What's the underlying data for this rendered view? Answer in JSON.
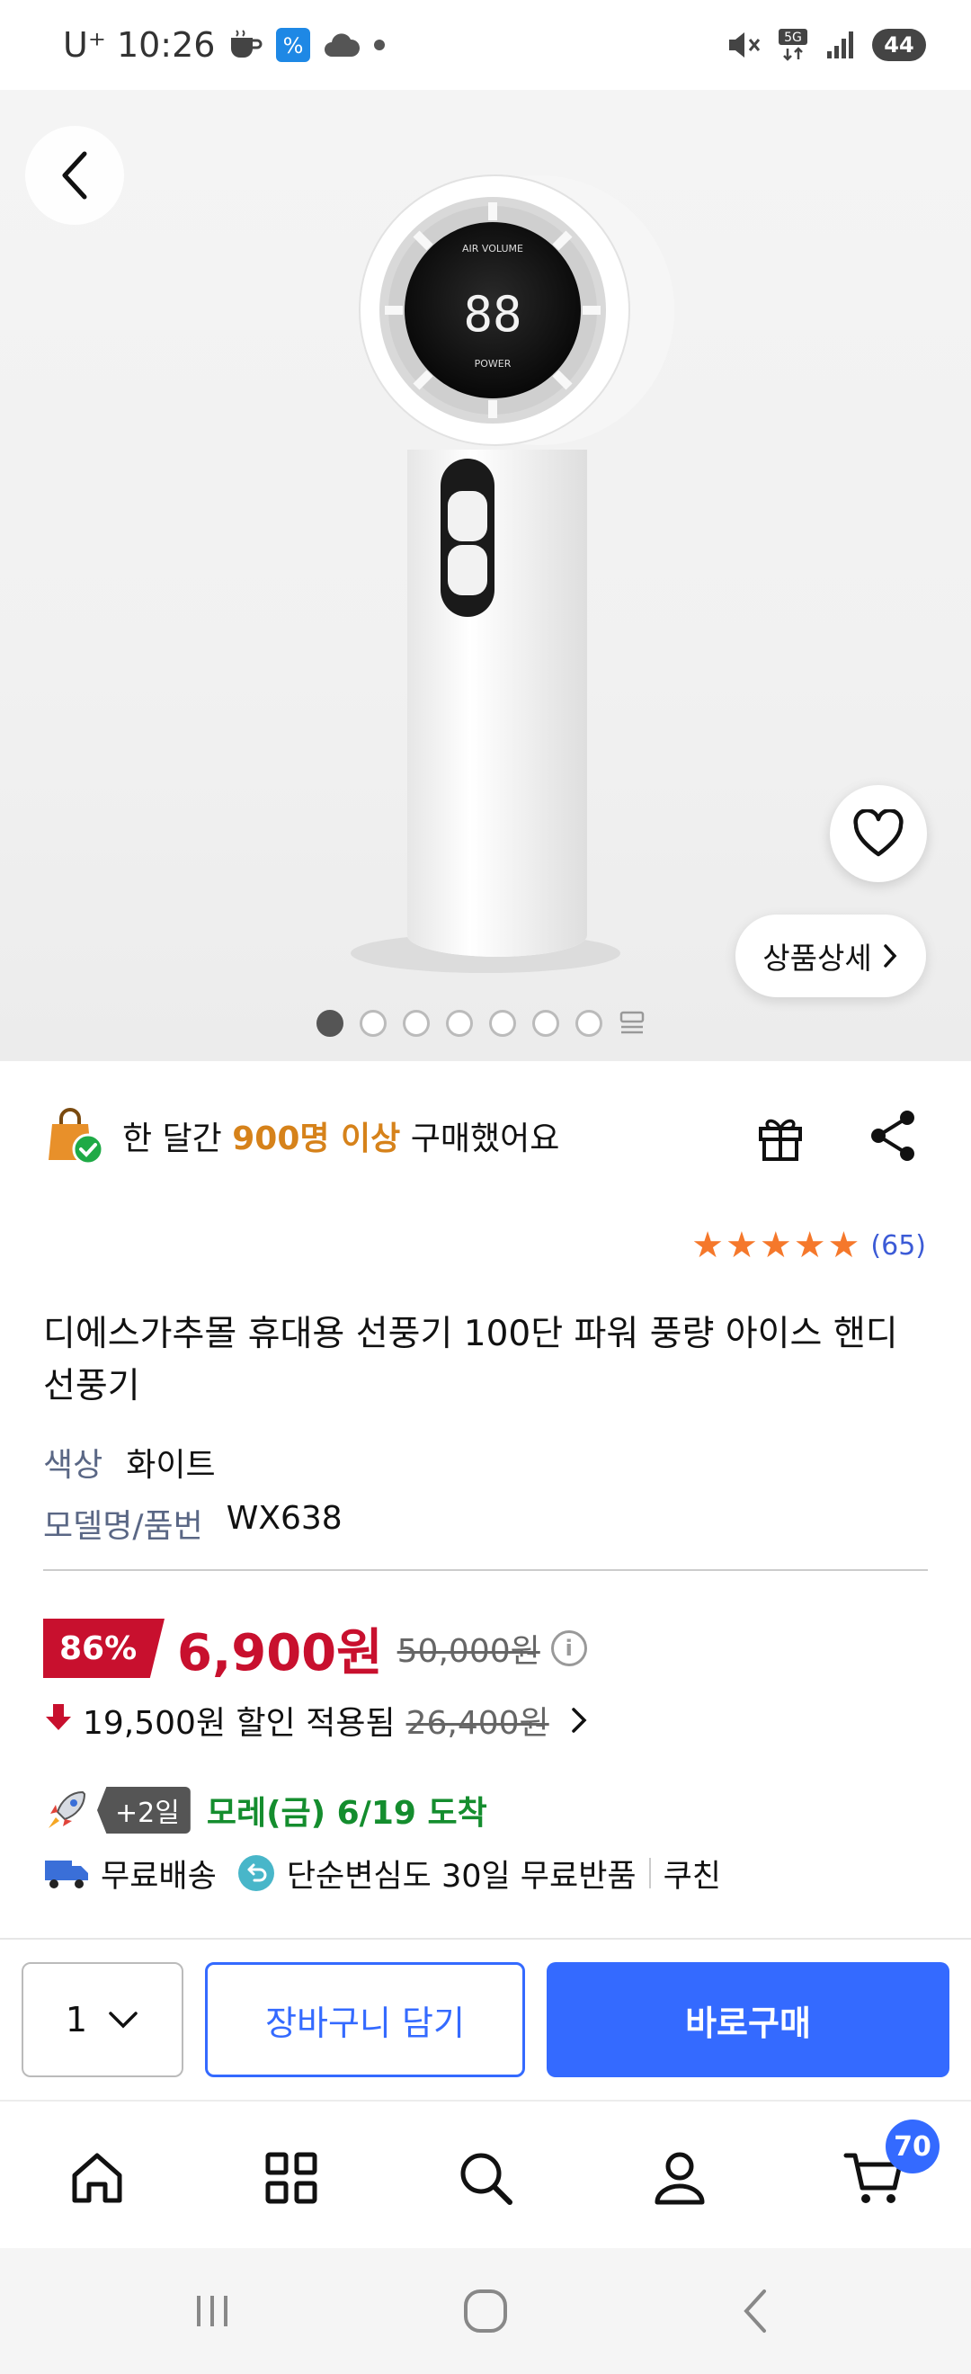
{
  "status_bar": {
    "carrier_time": "U⁺ 10:26",
    "network": "5G",
    "battery": "44"
  },
  "hero": {
    "detail_label": "상품상세",
    "image_count": 7,
    "active_index": 0,
    "product_screen": {
      "top_label": "AIR VOLUME",
      "value": "88",
      "bottom_label": "POWER"
    }
  },
  "purchase_info": {
    "prefix": "한 달간 ",
    "highlight": "900명 이상",
    "suffix": " 구매했어요"
  },
  "rating": {
    "stars": 5,
    "count": "(65)"
  },
  "product": {
    "title": "디에스가추몰 휴대용 선풍기 100단 파워 풍량 아이스 핸디 선풍기",
    "specs": [
      {
        "key": "색상",
        "value": "화이트"
      },
      {
        "key": "모델명/품번",
        "value": "WX638"
      }
    ]
  },
  "price": {
    "discount_rate": "86%",
    "price": "6,900원",
    "original": "50,000원",
    "discount_amount": "19,500원 할인 적용됨",
    "pre_discount": "26,400원"
  },
  "delivery": {
    "plus_days": "+2일",
    "arrival": "모레(금) 6/19 도착",
    "free_shipping": "무료배송",
    "return_policy": "단순변심도 30일 무료반품",
    "coupon": "쿠친"
  },
  "actions": {
    "quantity": "1",
    "add_to_cart": "장바구니 담기",
    "buy_now": "바로구매"
  },
  "bottom_nav": {
    "cart_count": "70"
  },
  "colors": {
    "accent_blue": "#346aff",
    "price_red": "#c8102e",
    "star_orange": "#f5782b",
    "arrival_green": "#148d2e"
  }
}
